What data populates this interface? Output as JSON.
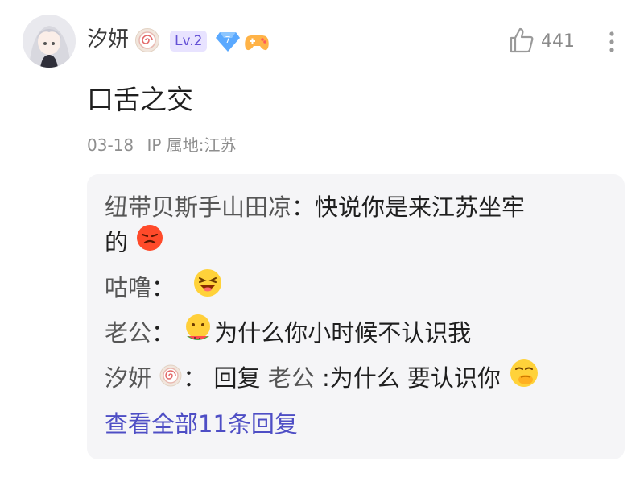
{
  "post": {
    "author": "汐妍",
    "level": "Lv.2",
    "gem_count": "7",
    "likes": "441",
    "content": "口舌之交",
    "date": "03-18",
    "ip_location": "IP 属地:江苏"
  },
  "replies": [
    {
      "name": "纽带贝斯手山田凉",
      "sep": "：",
      "text_line1": "快说你是来江苏坐牢",
      "text_line2": "的"
    },
    {
      "name": "咕噜",
      "sep": "："
    },
    {
      "name": "老公",
      "sep": "：",
      "text": "为什么你小时候不认识我"
    },
    {
      "name": "汐妍",
      "sep": "：",
      "reply_word": "回复",
      "reply_to": "老公",
      "text": ":为什么 要认识你"
    }
  ],
  "view_all": "查看全部11条回复",
  "icons": {
    "avatar": "avatar-anime-girl",
    "author_badge": "swirl-candy-badge-icon",
    "gem": "diamond-gem-icon",
    "game": "gamepad-icon",
    "like": "thumbs-up-icon",
    "more": "vertical-ellipsis-icon"
  },
  "colors": {
    "link": "#4e4ec5",
    "level_badge_bg": "#e8e3ff",
    "level_badge_text": "#6451d6",
    "reply_box_bg": "#f5f5f7"
  }
}
